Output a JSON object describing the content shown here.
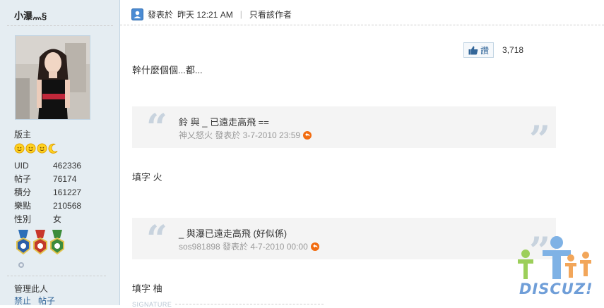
{
  "author": {
    "username": "小瀑灬§",
    "rank": "版主",
    "stats": [
      {
        "label": "UID",
        "value": "462336"
      },
      {
        "label": "帖子",
        "value": "76174"
      },
      {
        "label": "積分",
        "value": "161227"
      },
      {
        "label": "樂點",
        "value": "210568"
      },
      {
        "label": "性別",
        "value": "女"
      }
    ],
    "manage_title": "管理此人",
    "manage_links": [
      "禁止",
      "帖子"
    ]
  },
  "post": {
    "posted_prefix": "發表於",
    "posted_time": "昨天 12:21 AM",
    "separator": "|",
    "only_author": "只看該作者",
    "like_label": "讚",
    "like_count": "3,718",
    "body_1": "幹什麼個個...都...",
    "quote_1": {
      "text": "鈴 與 _ 已遠走高飛 ==",
      "meta": "神乂怒火 發表於 3-7-2010 23:59"
    },
    "body_2": "填字 火",
    "quote_2": {
      "text": "_ 與瀑已遠走高飛 (好似係)",
      "meta": "sos981898 發表於 4-7-2010 00:00"
    },
    "body_3": "填字 柚",
    "signature_label": "SIGNATURE"
  },
  "watermark": {
    "text": "DISCUZ!"
  },
  "colors": {
    "sidebar_bg": "#e5edf2",
    "link": "#336699",
    "quote_bg": "#f4f4f4",
    "quote_mark": "#c8d3de",
    "back_icon": "#f26c10"
  },
  "icons": {
    "online": "online-user-icon",
    "like": "thumbs-up-icon",
    "back": "back-arrow-icon",
    "quote_open": "open-quote-icon",
    "quote_close": "close-quote-icon",
    "stars": [
      "sun-icon",
      "sun-icon",
      "sun-icon",
      "moon-icon"
    ],
    "medals": [
      "medal-blue-icon",
      "medal-red-icon",
      "medal-green-icon"
    ]
  }
}
